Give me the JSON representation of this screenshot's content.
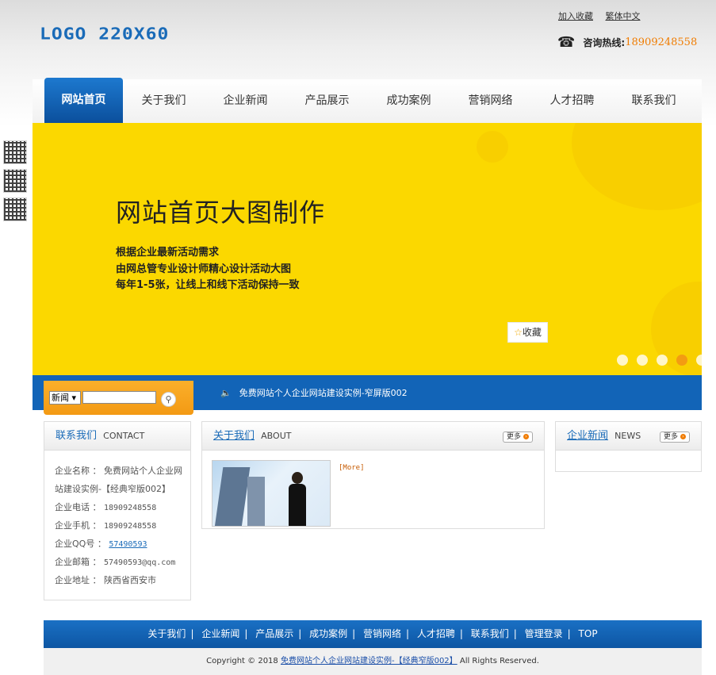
{
  "header": {
    "logo_text": "LOGO 220X60",
    "links": [
      "加入收藏",
      "繁体中文"
    ],
    "hotline_label": "咨询热线:",
    "hotline_number": "18909248558"
  },
  "nav": {
    "items": [
      "网站首页",
      "关于我们",
      "企业新闻",
      "产品展示",
      "成功案例",
      "营销网络",
      "人才招聘",
      "联系我们"
    ],
    "active_index": 0
  },
  "banner": {
    "title": "网站首页大图制作",
    "lines": [
      "根据企业最新活动需求",
      "由网总管专业设计师精心设计活动大图",
      "每年1-5张，让线上和线下活动保持一致"
    ],
    "favorite_label": "收藏",
    "slide_count": 5,
    "active_slide": 3
  },
  "search": {
    "select_value": "新闻",
    "input_value": ""
  },
  "news_ticker": "免费网站个人企业网站建设实例-窄屏版002",
  "contact_panel": {
    "title_cn": "联系我们",
    "title_en": "CONTACT",
    "rows": [
      {
        "label": "企业名称",
        "value": "免费网站个人企业网"
      },
      {
        "label": "",
        "value": "站建设实例-【经典窄版002】"
      },
      {
        "label": "企业电话",
        "value": "18909248558"
      },
      {
        "label": "企业手机",
        "value": "18909248558"
      },
      {
        "label": "企业QQ号",
        "value": "57490593"
      },
      {
        "label": "企业邮箱",
        "value": "57490593@qq.com"
      },
      {
        "label": "企业地址",
        "value": "陕西省西安市"
      }
    ]
  },
  "about_panel": {
    "title_cn": "关于我们",
    "title_en": "ABOUT",
    "more_label": "更多",
    "more_link": "[More]"
  },
  "news_panel": {
    "title_cn": "企业新闻",
    "title_en": "NEWS",
    "more_label": "更多"
  },
  "footer": {
    "links": [
      "关于我们",
      "企业新闻",
      "产品展示",
      "成功案例",
      "营销网络",
      "人才招聘",
      "联系我们",
      "管理登录",
      "TOP"
    ],
    "copyright_prefix": "Copyright © 2018",
    "copyright_link": "免费网站个人企业网站建设实例-【经典窄版002】",
    "copyright_suffix": "All Rights Reserved."
  },
  "colors": {
    "brand_blue": "#1264b7",
    "banner_yellow": "#fbd800",
    "accent_orange": "#f39a14"
  }
}
